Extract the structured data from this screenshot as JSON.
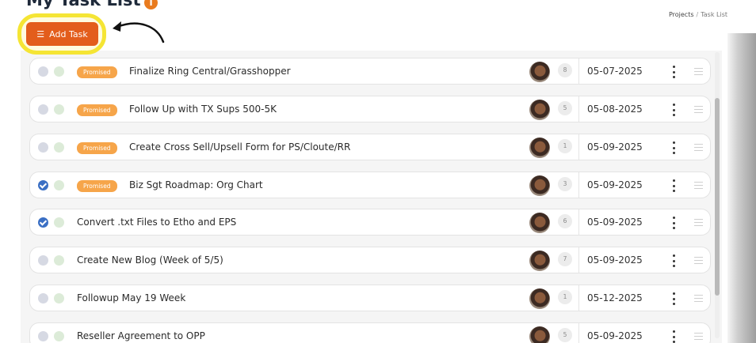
{
  "header": {
    "title": "My Task List",
    "info_icon": "i",
    "add_task_label": "Add Task"
  },
  "breadcrumb": {
    "items": [
      "Projects",
      "Task List"
    ],
    "separator": "/"
  },
  "tasks": [
    {
      "checked": false,
      "badge": "Promised",
      "title": "Finalize Ring Central/Grasshopper",
      "count": "8",
      "due": "05-07-2025"
    },
    {
      "checked": false,
      "badge": "Promised",
      "title": "Follow Up with TX Sups 500-5K",
      "count": "5",
      "due": "05-08-2025"
    },
    {
      "checked": false,
      "badge": "Promised",
      "title": "Create Cross Sell/Upsell Form for PS/Cloute/RR",
      "count": "1",
      "due": "05-09-2025"
    },
    {
      "checked": true,
      "badge": "Promised",
      "title": "Biz Sgt Roadmap: Org Chart",
      "count": "3",
      "due": "05-09-2025"
    },
    {
      "checked": true,
      "badge": "",
      "title": "Convert .txt Files to Etho and EPS",
      "count": "6",
      "due": "05-09-2025"
    },
    {
      "checked": false,
      "badge": "",
      "title": "Create New Blog (Week of 5/5)",
      "count": "7",
      "due": "05-09-2025"
    },
    {
      "checked": false,
      "badge": "",
      "title": "Followup May 19 Week",
      "count": "1",
      "due": "05-12-2025"
    },
    {
      "checked": false,
      "badge": "",
      "title": "Reseller Agreement to OPP",
      "count": "5",
      "due": "05-09-2025"
    }
  ],
  "icons": {
    "add_task": "list-icon",
    "row_menu": "kebab-icon",
    "row_drag": "drag-handle-icon",
    "info": "info-icon"
  },
  "colors": {
    "accent": "#e35d1c",
    "highlight": "#f5e534",
    "promised_badge": "#f6a54a",
    "check_done": "#3a6fc4",
    "info_icon": "#e97b1e"
  }
}
